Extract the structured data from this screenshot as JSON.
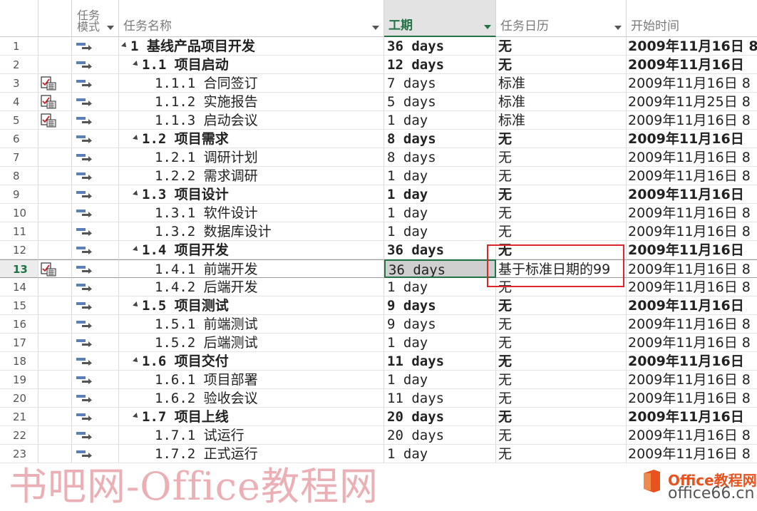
{
  "columns": {
    "mode_line1": "任务",
    "mode_line2": "模式",
    "name": "任务名称",
    "duration": "工期",
    "calendar": "任务日历",
    "start": "开始时间"
  },
  "colors": {
    "accent": "#217346",
    "highlight_box": "#e0262b",
    "info_icon": "#3a7bd5"
  },
  "selected_row": "13",
  "rows": [
    {
      "id": "1",
      "name": "1 基线产品项目开发",
      "summary": true,
      "level": 0,
      "duration": "36 days",
      "calendar": "无",
      "start": "2009年11月16日  8",
      "note": false
    },
    {
      "id": "2",
      "name": "1.1 项目启动",
      "summary": true,
      "level": 1,
      "duration": "12 days",
      "calendar": "无",
      "start": "2009年11月16日",
      "note": false
    },
    {
      "id": "3",
      "name": "1.1.1 合同签订",
      "summary": false,
      "level": 2,
      "duration": "7 days",
      "calendar": "标准",
      "start": "2009年11月16日  8",
      "note": true
    },
    {
      "id": "4",
      "name": "1.1.2 实施报告",
      "summary": false,
      "level": 2,
      "duration": "5 days",
      "calendar": "标准",
      "start": "2009年11月25日  8",
      "note": true
    },
    {
      "id": "5",
      "name": "1.1.3 启动会议",
      "summary": false,
      "level": 2,
      "duration": "1 day",
      "calendar": "标准",
      "start": "2009年11月16日  8",
      "note": true
    },
    {
      "id": "6",
      "name": "1.2 项目需求",
      "summary": true,
      "level": 1,
      "duration": "8 days",
      "calendar": "无",
      "start": "2009年11月16日",
      "note": false
    },
    {
      "id": "7",
      "name": "1.2.1 调研计划",
      "summary": false,
      "level": 2,
      "duration": "8 days",
      "calendar": "无",
      "start": "2009年11月16日  8",
      "note": false
    },
    {
      "id": "8",
      "name": "1.2.2 需求调研",
      "summary": false,
      "level": 2,
      "duration": "1 day",
      "calendar": "无",
      "start": "2009年11月16日  8",
      "note": false
    },
    {
      "id": "9",
      "name": "1.3 项目设计",
      "summary": true,
      "level": 1,
      "duration": "1 day",
      "calendar": "无",
      "start": "2009年11月16日",
      "note": false
    },
    {
      "id": "10",
      "name": "1.3.1 软件设计",
      "summary": false,
      "level": 2,
      "duration": "1 day",
      "calendar": "无",
      "start": "2009年11月16日  8",
      "note": false
    },
    {
      "id": "11",
      "name": "1.3.2 数据库设计",
      "summary": false,
      "level": 2,
      "duration": "1 day",
      "calendar": "无",
      "start": "2009年11月16日  8",
      "note": false
    },
    {
      "id": "12",
      "name": "1.4 项目开发",
      "summary": true,
      "level": 1,
      "duration": "36 days",
      "calendar": "无",
      "start": "2009年11月16日",
      "note": false
    },
    {
      "id": "13",
      "name": "1.4.1 前端开发",
      "summary": false,
      "level": 2,
      "duration": "36 days",
      "calendar": "基于标准日期的99",
      "start": "2009年11月16日  8",
      "note": true
    },
    {
      "id": "14",
      "name": "1.4.2 后端开发",
      "summary": false,
      "level": 2,
      "duration": "1 day",
      "calendar": "无",
      "start": "2009年11月16日  8",
      "note": false
    },
    {
      "id": "15",
      "name": "1.5 项目测试",
      "summary": true,
      "level": 1,
      "duration": "9 days",
      "calendar": "无",
      "start": "2009年11月16日",
      "note": false
    },
    {
      "id": "16",
      "name": "1.5.1 前端测试",
      "summary": false,
      "level": 2,
      "duration": "9 days",
      "calendar": "无",
      "start": "2009年11月16日  8",
      "note": false
    },
    {
      "id": "17",
      "name": "1.5.2 后端测试",
      "summary": false,
      "level": 2,
      "duration": "1 day",
      "calendar": "无",
      "start": "2009年11月16日  8",
      "note": false
    },
    {
      "id": "18",
      "name": "1.6 项目交付",
      "summary": true,
      "level": 1,
      "duration": "11 days",
      "calendar": "无",
      "start": "2009年11月16日",
      "note": false
    },
    {
      "id": "19",
      "name": "1.6.1 项目部署",
      "summary": false,
      "level": 2,
      "duration": "1 day",
      "calendar": "无",
      "start": "2009年11月16日  8",
      "note": false
    },
    {
      "id": "20",
      "name": "1.6.2 验收会议",
      "summary": false,
      "level": 2,
      "duration": "11 days",
      "calendar": "无",
      "start": "2009年11月16日  8",
      "note": false
    },
    {
      "id": "21",
      "name": "1.7 项目上线",
      "summary": true,
      "level": 1,
      "duration": "20 days",
      "calendar": "无",
      "start": "2009年11月16日",
      "note": false
    },
    {
      "id": "22",
      "name": "1.7.1 试运行",
      "summary": false,
      "level": 2,
      "duration": "20 days",
      "calendar": "无",
      "start": "2009年11月16日  8",
      "note": false
    },
    {
      "id": "23",
      "name": "1.7.2 正式运行",
      "summary": false,
      "level": 2,
      "duration": "1 day",
      "calendar": "无",
      "start": "2009年11月16日  8",
      "note": false
    }
  ],
  "watermark": {
    "left_text": "书吧网-Office教程网",
    "logo_line1": "Office教程网",
    "logo_line2": "office66.cn"
  }
}
